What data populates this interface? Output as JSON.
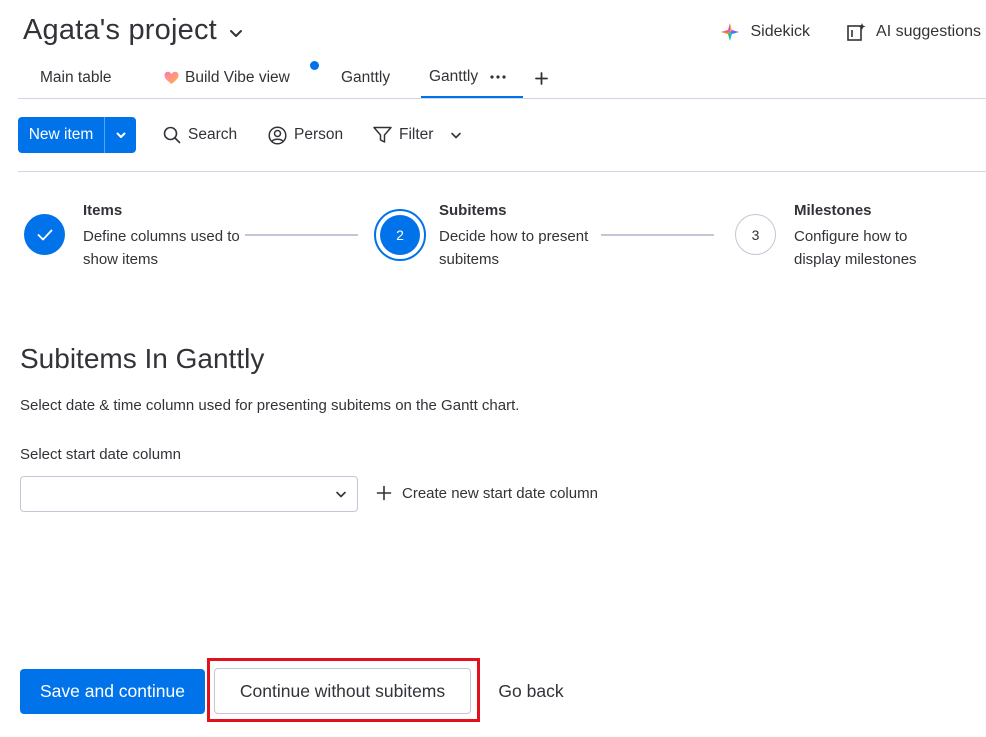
{
  "header": {
    "project_title": "Agata's project",
    "sidekick_label": "Sidekick",
    "ai_suggestions_label": "AI suggestions"
  },
  "tabs": [
    {
      "label": "Main table"
    },
    {
      "label": "Build Vibe view"
    },
    {
      "label": "Ganttly"
    },
    {
      "label": "Ganttly",
      "active": true
    }
  ],
  "toolbar": {
    "new_item_label": "New item",
    "search_label": "Search",
    "person_label": "Person",
    "filter_label": "Filter"
  },
  "stepper": {
    "steps": [
      {
        "title": "Items",
        "description": "Define columns used to show items",
        "state": "completed"
      },
      {
        "number": "2",
        "title": "Subitems",
        "description": "Decide how to present subitems",
        "state": "active"
      },
      {
        "number": "3",
        "title": "Milestones",
        "description": "Configure how to display milestones",
        "state": "pending"
      }
    ]
  },
  "content": {
    "title": "Subitems In Ganttly",
    "description": "Select date & time column used for presenting subitems on the Gantt chart.",
    "field_label": "Select start date column",
    "select_value": "",
    "create_column_label": "Create new start date column"
  },
  "footer": {
    "save_label": "Save and continue",
    "continue_label": "Continue without subitems",
    "back_label": "Go back"
  },
  "colors": {
    "primary": "#0073ea",
    "text": "#323338",
    "border": "#c3c6d4",
    "highlight": "#e2111d"
  }
}
